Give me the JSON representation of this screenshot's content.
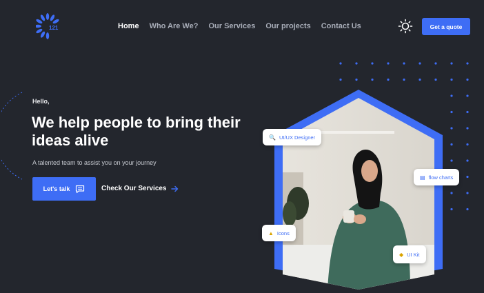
{
  "brand": {
    "logo_text": "121"
  },
  "nav": {
    "items": [
      {
        "label": "Home",
        "active": true
      },
      {
        "label": "Who Are We?",
        "active": false
      },
      {
        "label": "Our Services",
        "active": false
      },
      {
        "label": "Our projects",
        "active": false
      },
      {
        "label": "Contact Us",
        "active": false
      }
    ]
  },
  "header": {
    "quote_button": "Get a quote"
  },
  "hero": {
    "greeting": "Hello,",
    "headline": "We help people to bring their ideas alive",
    "tagline": "A talented team to assist you on your journey",
    "primary_button": "Let's talk",
    "secondary_link": "Check Our Services"
  },
  "chips": [
    {
      "label": "UI/UX Designer",
      "icon": "search-icon"
    },
    {
      "label": "flow charts",
      "icon": "chart-icon"
    },
    {
      "label": "Icons",
      "icon": "bell-icon"
    },
    {
      "label": "UI Kit",
      "icon": "tag-icon"
    }
  ],
  "colors": {
    "background": "#23262d",
    "accent": "#3e6df5",
    "nav_text": "#a8adb8"
  }
}
